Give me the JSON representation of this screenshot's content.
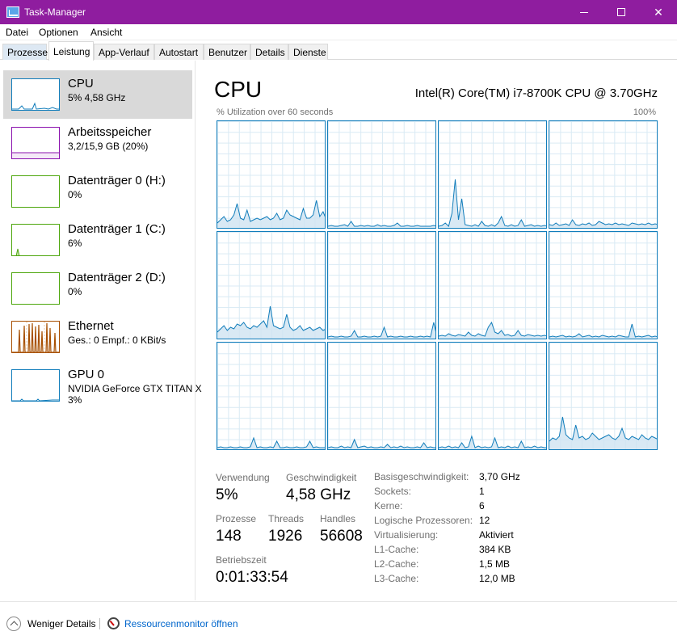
{
  "window": {
    "title": "Task-Manager"
  },
  "menu": {
    "items": [
      "Datei",
      "Optionen",
      "Ansicht"
    ]
  },
  "tabs": [
    "Prozesse",
    "Leistung",
    "App-Verlauf",
    "Autostart",
    "Benutzer",
    "Details",
    "Dienste"
  ],
  "active_tab": "Leistung",
  "sidebar": {
    "items": [
      {
        "title": "CPU",
        "sub": "5% 4,58 GHz",
        "color": "#117dbb"
      },
      {
        "title": "Arbeitsspeicher",
        "sub": "3,2/15,9 GB (20%)",
        "color": "#8b12ae"
      },
      {
        "title": "Datenträger 0 (H:)",
        "sub": "0%",
        "color": "#4da60c"
      },
      {
        "title": "Datenträger 1 (C:)",
        "sub": "6%",
        "color": "#4da60c"
      },
      {
        "title": "Datenträger 2 (D:)",
        "sub": "0%",
        "color": "#4da60c"
      },
      {
        "title": "Ethernet",
        "sub": "Ges.: 0 Empf.: 0 KBit/s",
        "color": "#a74f01"
      },
      {
        "title": "GPU 0",
        "sub": "NVIDIA GeForce GTX TITAN X",
        "sub2": "3%",
        "color": "#117dbb"
      }
    ]
  },
  "main": {
    "title": "CPU",
    "model": "Intel(R) Core(TM) i7-8700K CPU @ 3.70GHz",
    "graph_caption": "% Utilization over 60 seconds",
    "graph_max": "100%",
    "graph_color": "#117dbb",
    "logical_processor_graphs": 12
  },
  "stats": {
    "usage_label": "Verwendung",
    "usage_value": "5%",
    "speed_label": "Geschwindigkeit",
    "speed_value": "4,58 GHz",
    "processes_label": "Prozesse",
    "processes_value": "148",
    "threads_label": "Threads",
    "threads_value": "1926",
    "handles_label": "Handles",
    "handles_value": "56608",
    "uptime_label": "Betriebszeit",
    "uptime_value": "0:01:33:54"
  },
  "details": [
    {
      "label": "Basisgeschwindigkeit:",
      "value": "3,70 GHz"
    },
    {
      "label": "Sockets:",
      "value": "1"
    },
    {
      "label": "Kerne:",
      "value": "6"
    },
    {
      "label": "Logische Prozessoren:",
      "value": "12"
    },
    {
      "label": "Virtualisierung:",
      "value": "Aktiviert"
    },
    {
      "label": "L1-Cache:",
      "value": "384 KB"
    },
    {
      "label": "L2-Cache:",
      "value": "1,5 MB"
    },
    {
      "label": "L3-Cache:",
      "value": "12,0 MB"
    }
  ],
  "footer": {
    "fewer_details": "Weniger Details",
    "resource_monitor": "Ressourcenmonitor öffnen"
  }
}
